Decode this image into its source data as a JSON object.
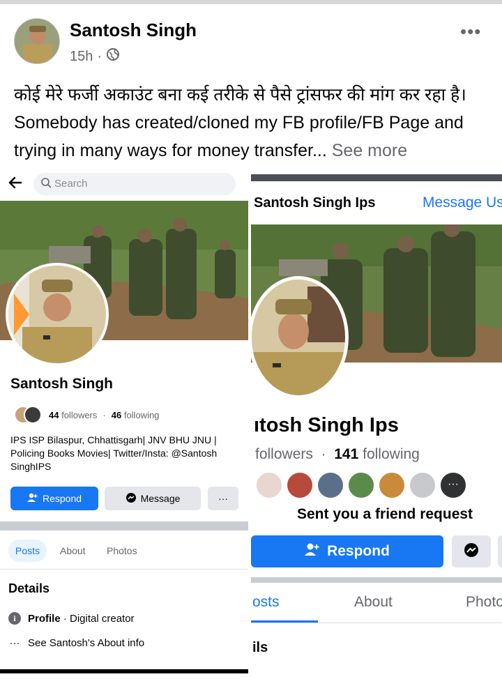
{
  "post": {
    "author": "Santosh Singh",
    "time": "15h",
    "more_icon": "more-horizontal-icon",
    "text_hindi": "कोई मेरे फर्जी अकाउंट बना कई तरीके से पैसे ट्रांसफर की मांग कर रहा है।",
    "text_english": " Somebody has created/cloned my FB profile/FB Page and trying in many ways for money transfer...",
    "see_more": "See more"
  },
  "left_screenshot": {
    "search_placeholder": "Search",
    "profile_name": "Santosh Singh",
    "followers_count": "44",
    "followers_label": "followers",
    "following_count": "46",
    "following_label": "following",
    "bio": "IPS ISP Bilaspur, Chhattisgarh| JNV BHU JNU | Policing Books Movies| Twitter/Insta: @Santosh SinghIPS",
    "respond_label": "Respond",
    "message_label": "Message",
    "more_label": "···",
    "tabs": [
      "Posts",
      "About",
      "Photos"
    ],
    "details_title": "Details",
    "profile_label": "Profile",
    "profile_type": " · Digital creator",
    "about_link": "See Santosh's About info"
  },
  "right_screenshot": {
    "page_name": "Santosh Singh Ips",
    "message_us": "Message Us",
    "profile_name_partial": "ıtosh Singh Ips",
    "followers_label": "followers",
    "following_count": "141",
    "following_label": "following",
    "friend_request": "Sent you a friend request",
    "respond_label": "Respond",
    "tabs": [
      "osts",
      "About",
      "Photo"
    ],
    "details_partial": "ils"
  },
  "colors": {
    "accent": "#1877f2",
    "secondary_text": "#65676b",
    "button_grey": "#e4e6eb"
  }
}
